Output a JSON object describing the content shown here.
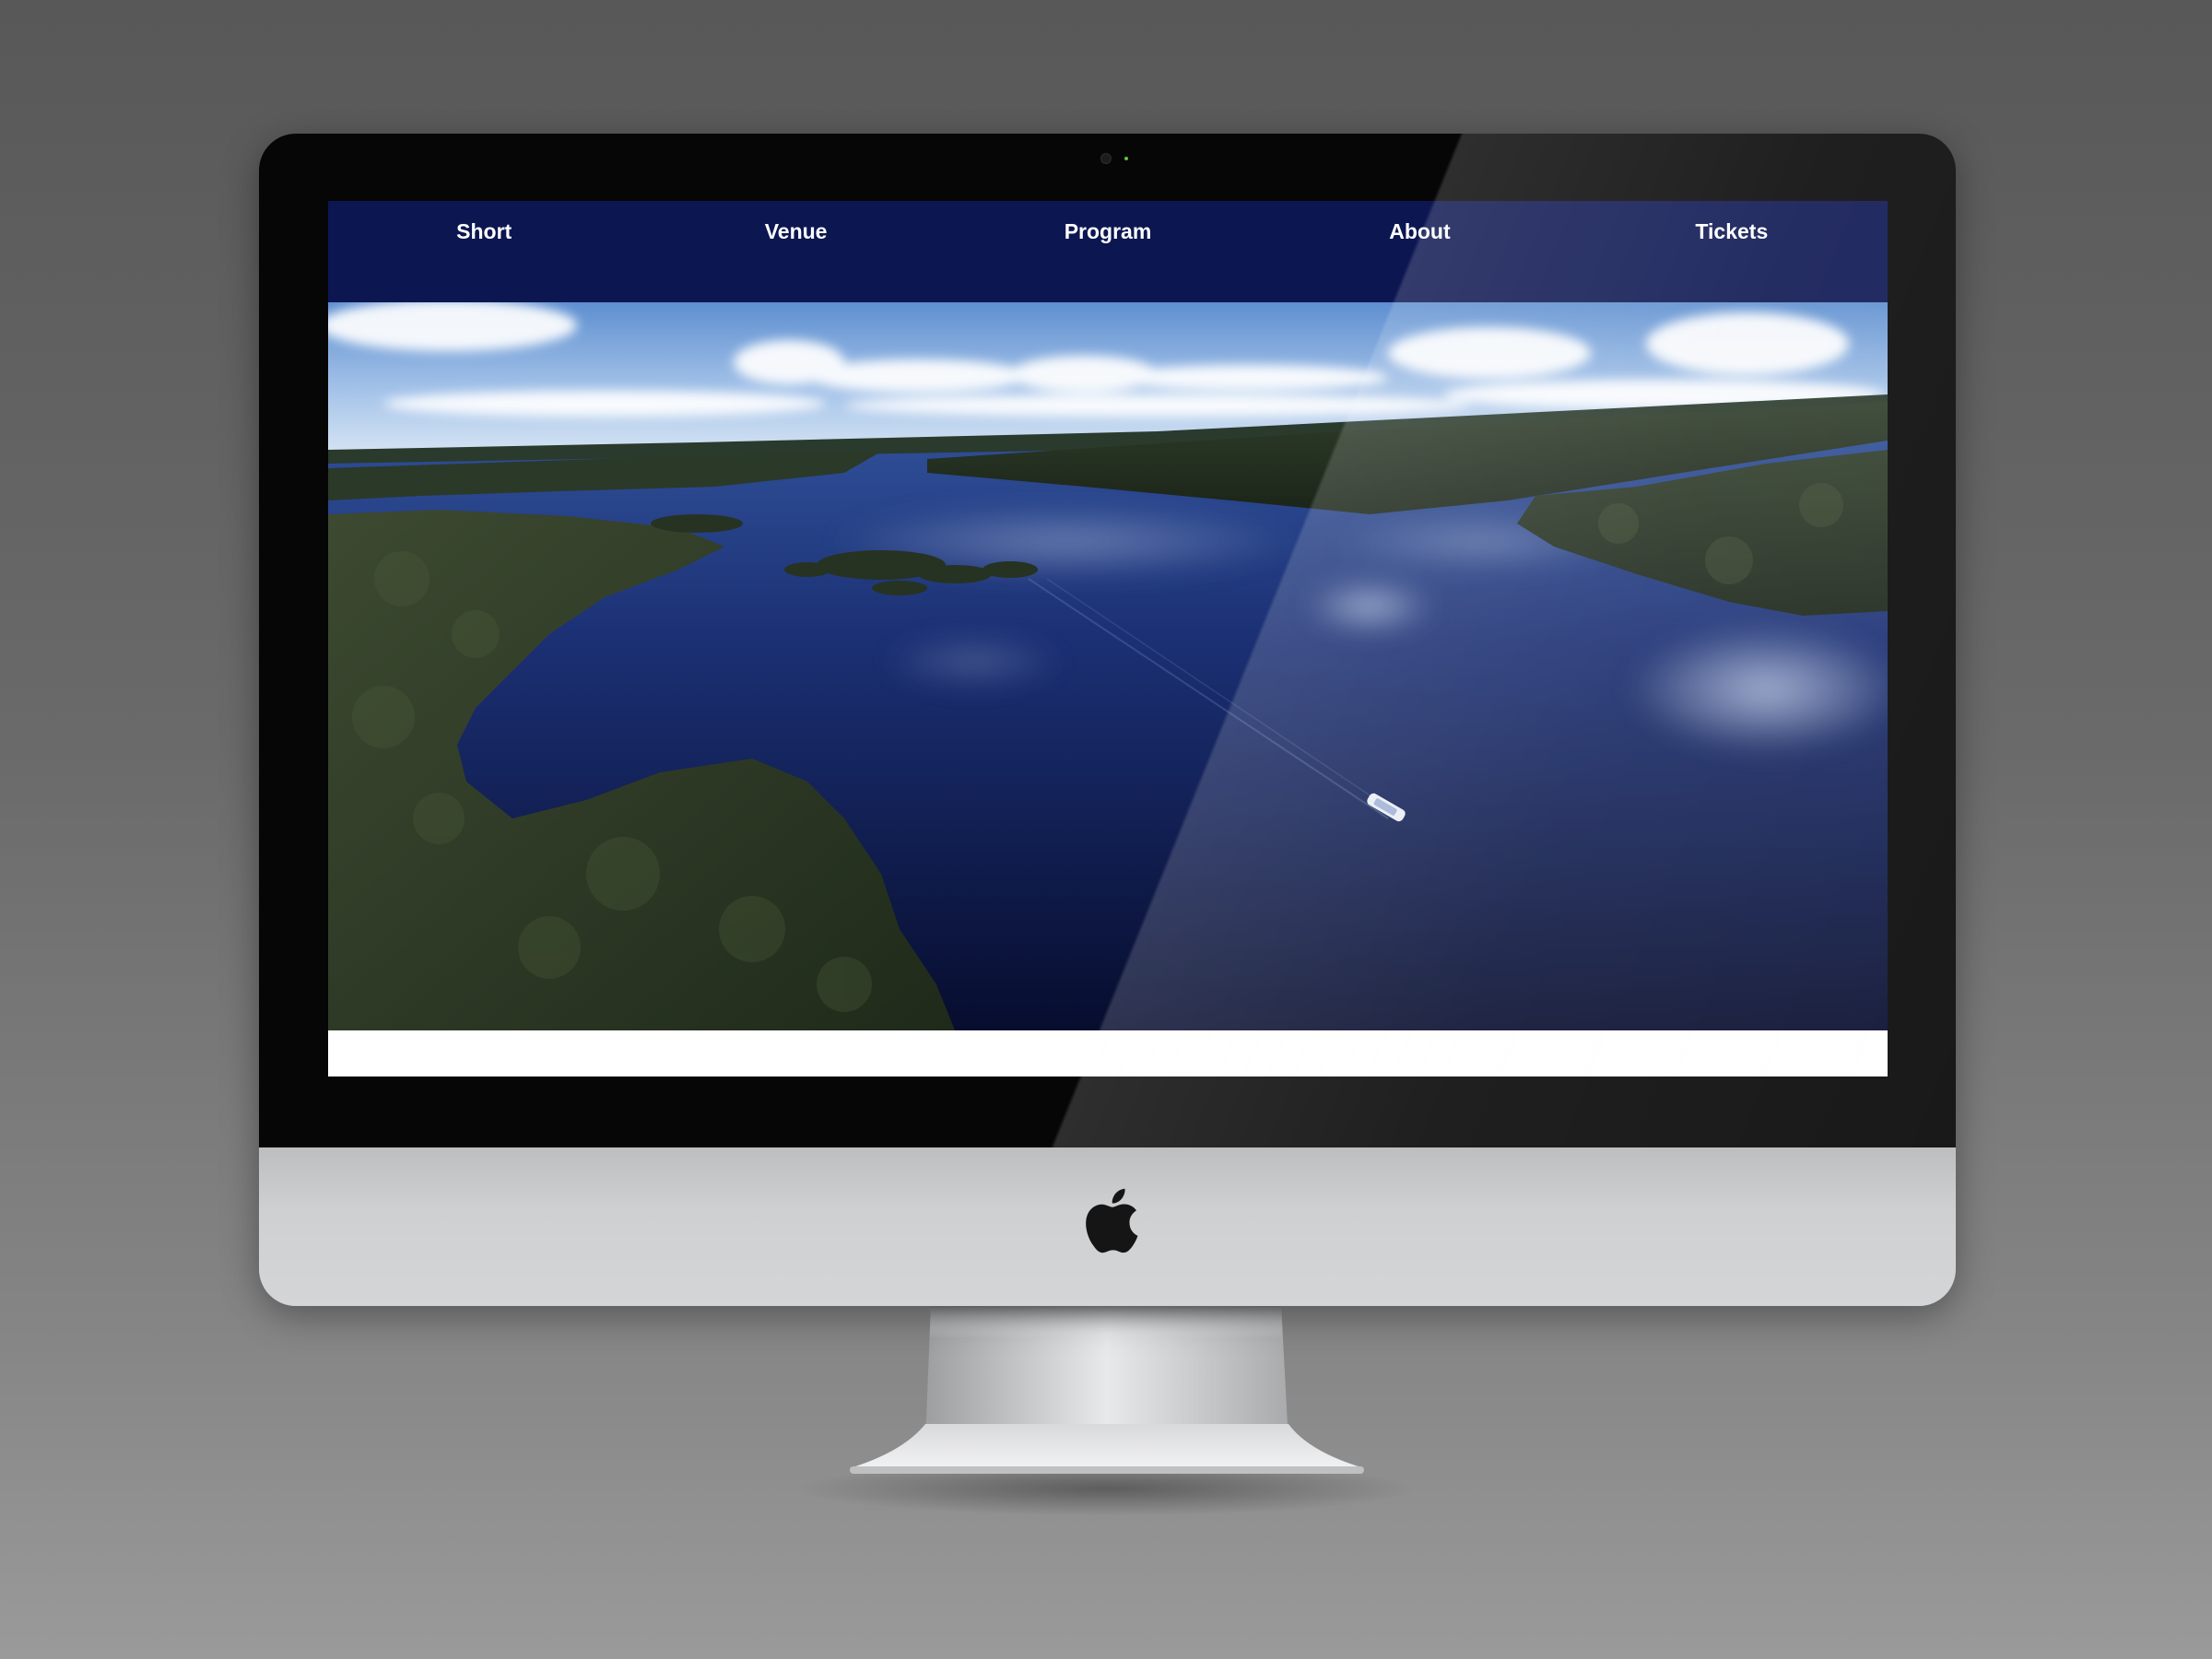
{
  "nav": {
    "items": [
      {
        "label": "Short"
      },
      {
        "label": "Venue"
      },
      {
        "label": "Program"
      },
      {
        "label": "About"
      },
      {
        "label": "Tickets"
      }
    ]
  },
  "hero": {
    "image": "aerial-river-photo",
    "subject": "boat"
  },
  "device": {
    "logo": "apple-logo"
  },
  "colors": {
    "nav_background": "#0c1651",
    "nav_text": "#ffffff",
    "water": "#0d1c4e",
    "forest": "#2b3a24",
    "sky": "#7fa8d8",
    "bezel": "#060606",
    "chin": "#cfd0d2"
  }
}
